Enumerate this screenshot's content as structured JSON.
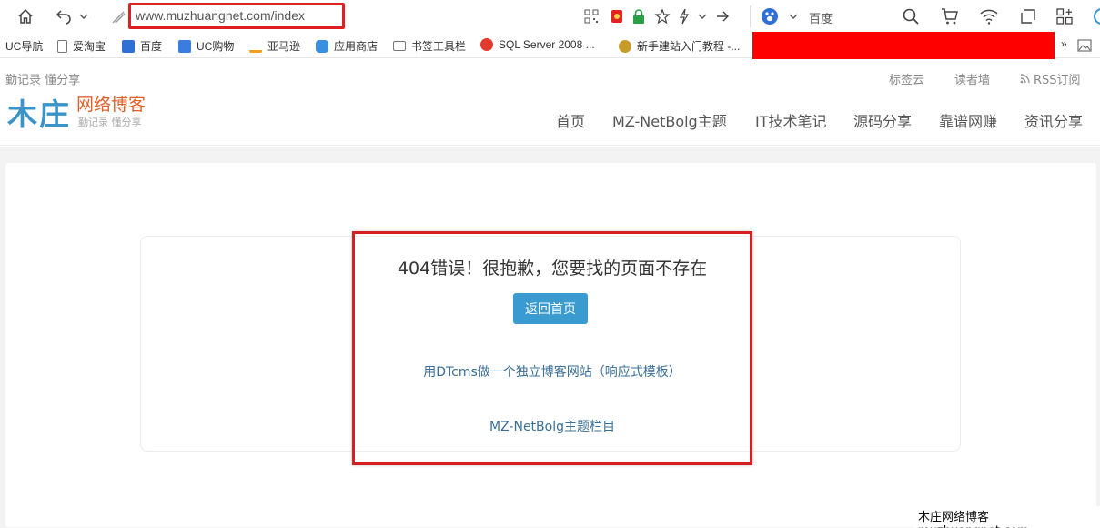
{
  "browser": {
    "url": "www.muzhuangnet.com/index",
    "search_engine": "百度",
    "accent_color": "#e02020"
  },
  "bookmarks": [
    {
      "label": "UC导航",
      "icon": "none"
    },
    {
      "label": "爱淘宝",
      "icon": "page-icon"
    },
    {
      "label": "百度",
      "icon": "baidu-icon"
    },
    {
      "label": "UC购物",
      "icon": "uc-shopping-icon"
    },
    {
      "label": "亚马逊",
      "icon": "amazon-icon"
    },
    {
      "label": "应用商店",
      "icon": "app-store-icon"
    },
    {
      "label": "书签工具栏",
      "icon": "folder-icon"
    },
    {
      "label": "SQL Server 2008 ...",
      "icon": "weibo-icon"
    },
    {
      "label": "新手建站入门教程 -...",
      "icon": "site-icon"
    }
  ],
  "site": {
    "slogan": "勤记录 懂分享",
    "logo_text": "木庄",
    "logo_title": "网络博客",
    "logo_sub": "勤记录  懂分享",
    "top_links": [
      "标签云",
      "读者墙",
      "RSS订阅"
    ],
    "nav": [
      "首页",
      "MZ-NetBolg主题",
      "IT技术笔记",
      "源码分享",
      "靠谱网赚",
      "资讯分享"
    ],
    "brand_blue": "#3a94c8",
    "brand_orange": "#e0602a"
  },
  "error": {
    "title": "404错误！很抱歉，您要找的页面不存在",
    "home_button": "返回首页",
    "links": [
      "用DTcms做一个独立博客网站（响应式模板）",
      "MZ-NetBolg主题栏目"
    ]
  },
  "watermark": "木庄网络博客 muzhuangnet.com"
}
